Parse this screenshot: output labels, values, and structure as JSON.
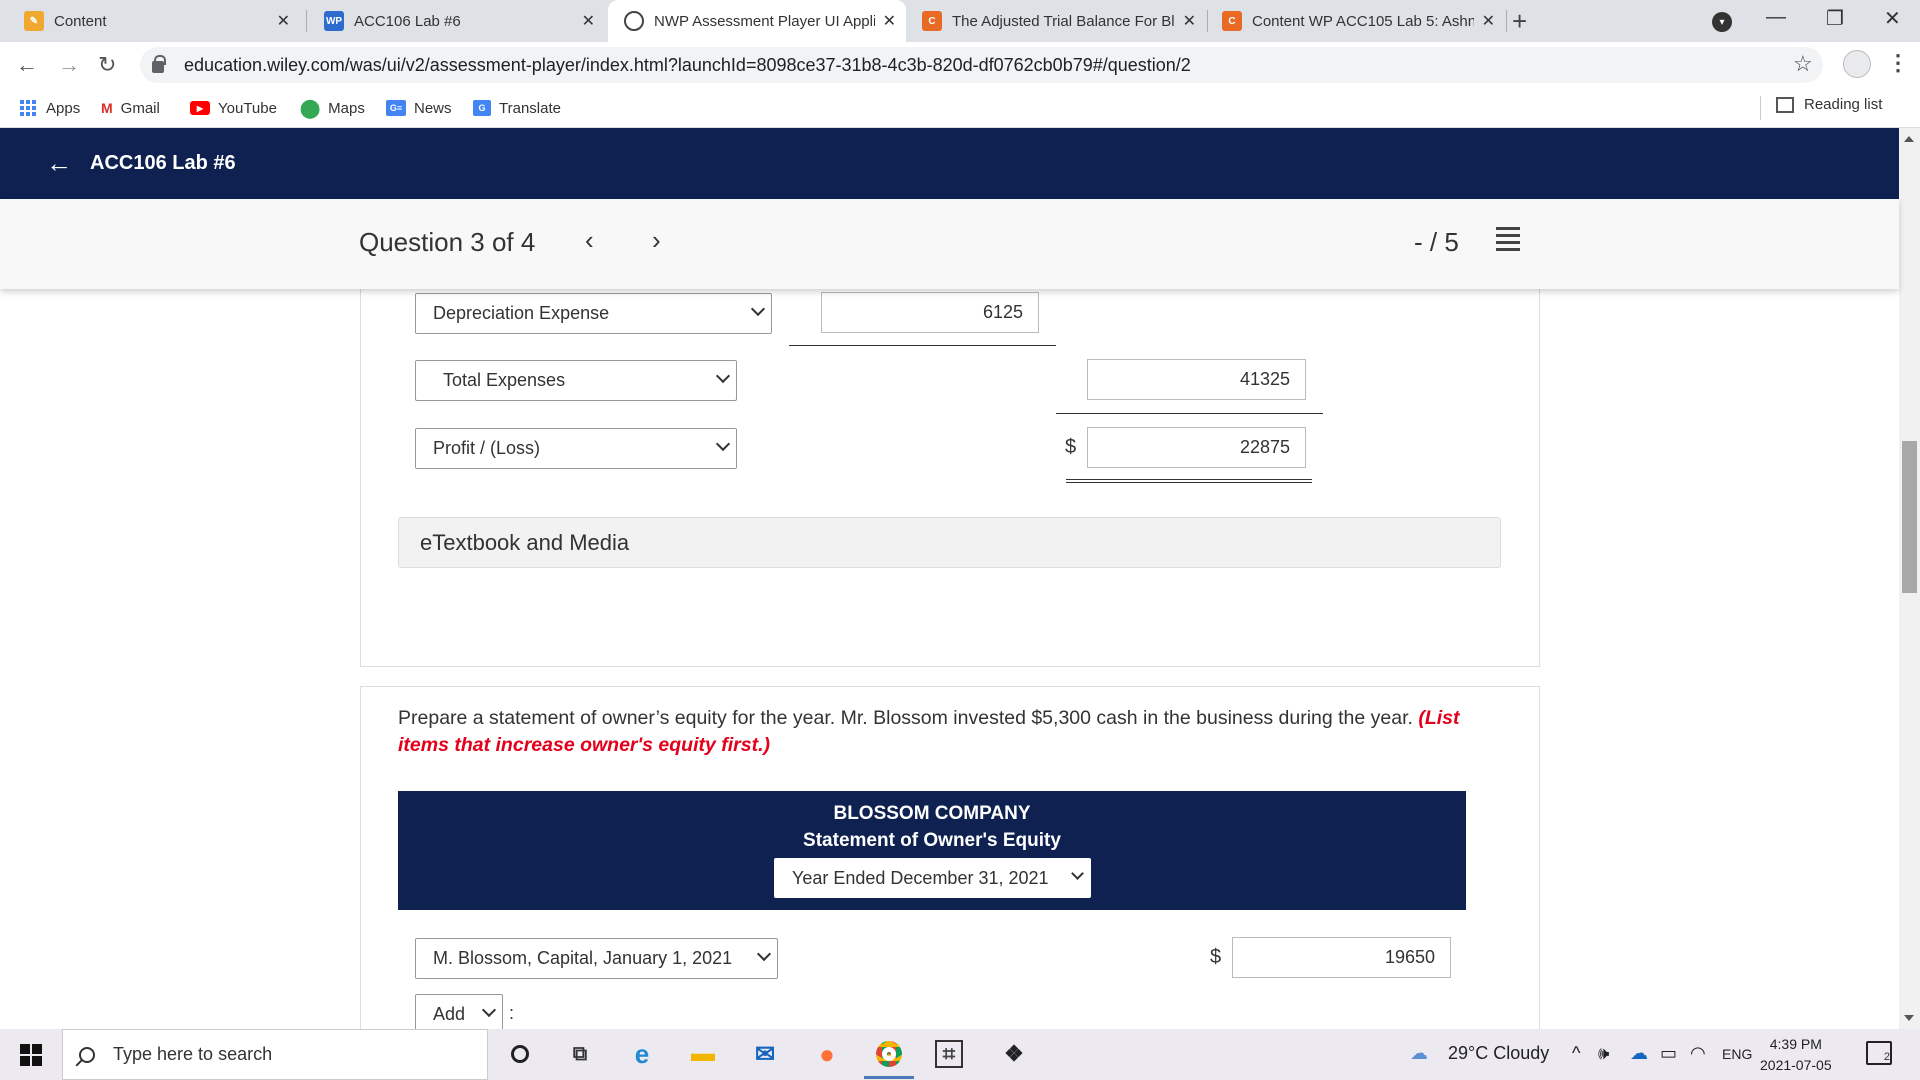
{
  "browser": {
    "tabs": [
      {
        "title": "Content",
        "favicon": "pencil-icon"
      },
      {
        "title": "ACC106 Lab #6",
        "favicon": "wp-icon",
        "favicon_text": "WP"
      },
      {
        "title": "NWP Assessment Player UI Appli",
        "favicon": "globe-icon"
      },
      {
        "title": "The Adjusted Trial Balance For Bl",
        "favicon": "chegg-icon",
        "favicon_text": "C"
      },
      {
        "title": "Content WP ACC105 Lab 5: Ashn",
        "favicon": "chegg-icon",
        "favicon_text": "C"
      }
    ],
    "url": "education.wiley.com/was/ui/v2/assessment-player/index.html?launchId=8098ce37-31b8-4c3b-820d-df0762cb0b79#/question/2",
    "bookmarks": [
      "Apps",
      "Gmail",
      "YouTube",
      "Maps",
      "News",
      "Translate"
    ],
    "reading_list": "Reading list"
  },
  "app": {
    "title": "ACC106 Lab #6",
    "question_label": "Question 3 of 4",
    "score": "- / 5"
  },
  "income_statement": {
    "depreciation_label": "Depreciation Expense",
    "depreciation_value": "6125",
    "total_expenses_label": "Total Expenses",
    "total_expenses_value": "41325",
    "profit_label": "Profit / (Loss)",
    "profit_currency": "$",
    "profit_value": "22875",
    "etextbook": "eTextbook and Media"
  },
  "owners_equity": {
    "instruction": "Prepare a statement of owner’s equity for the year. Mr. Blossom invested $5,300 cash in the business during the year.",
    "instruction_hint": "(List items that increase owner's equity first.)",
    "company": "BLOSSOM COMPANY",
    "statement": "Statement of Owner's Equity",
    "period": "Year Ended December 31, 2021",
    "capital_label": "M. Blossom, Capital, January 1, 2021",
    "capital_currency": "$",
    "capital_value": "19650",
    "add_label": "Add",
    "add_suffix": ":"
  },
  "taskbar": {
    "search_placeholder": "Type here to search",
    "weather": "29°C  Cloudy",
    "lang": "ENG",
    "time": "4:39 PM",
    "date": "2021-07-05",
    "notif_count": "2"
  },
  "colors": {
    "brand_navy": "#0e2150",
    "hint_red": "#e3001b"
  }
}
